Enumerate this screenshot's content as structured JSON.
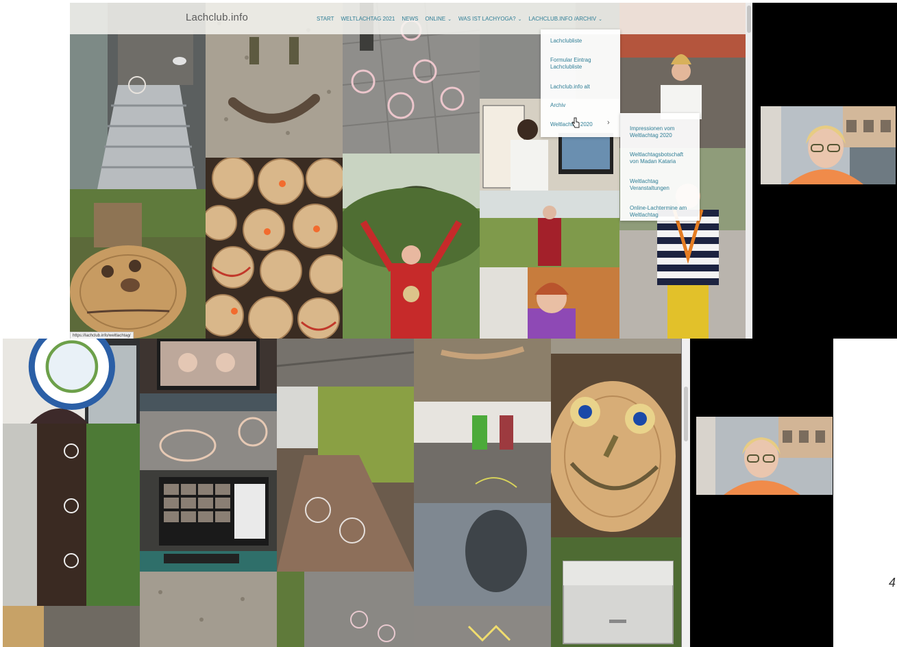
{
  "website": {
    "logo": "Lachclub.info",
    "nav": [
      {
        "label": "START",
        "has_submenu": false
      },
      {
        "label": "WELTLACHTAG 2021",
        "has_submenu": false
      },
      {
        "label": "NEWS",
        "has_submenu": false
      },
      {
        "label": "ONLINE",
        "has_submenu": true
      },
      {
        "label": "WAS IST LACHYOGA?",
        "has_submenu": true
      },
      {
        "label": "LACHCLUB.INFO /ARCHIV",
        "has_submenu": true
      }
    ],
    "dropdown_archiv": {
      "items": [
        "Lachclubliste",
        "Formular Eintrag Lachclubliste",
        "Lachclub.info alt",
        "Archiv",
        "Weltlachtag 2020"
      ],
      "submenu_arrow": "›"
    },
    "dropdown_weltlachtag": {
      "items": [
        "Impressionen vom Weltlachtag 2020",
        "Weltlachtagsbotschaft von Madan Kataria",
        "Weltlachtag Veranstaltungen",
        "Online-Lachtermine am Weltlachtag"
      ]
    },
    "status_url": "https://lachclub.info/weltlachtag/",
    "link_color": "#2f7e96"
  },
  "page_number": "4",
  "icons": {
    "nav_chevron": "chevron-down-icon",
    "submenu_chevron": "chevron-right-icon",
    "cursor": "hand-cursor-icon",
    "logo_badge": "lachyoga-badge-icon"
  }
}
